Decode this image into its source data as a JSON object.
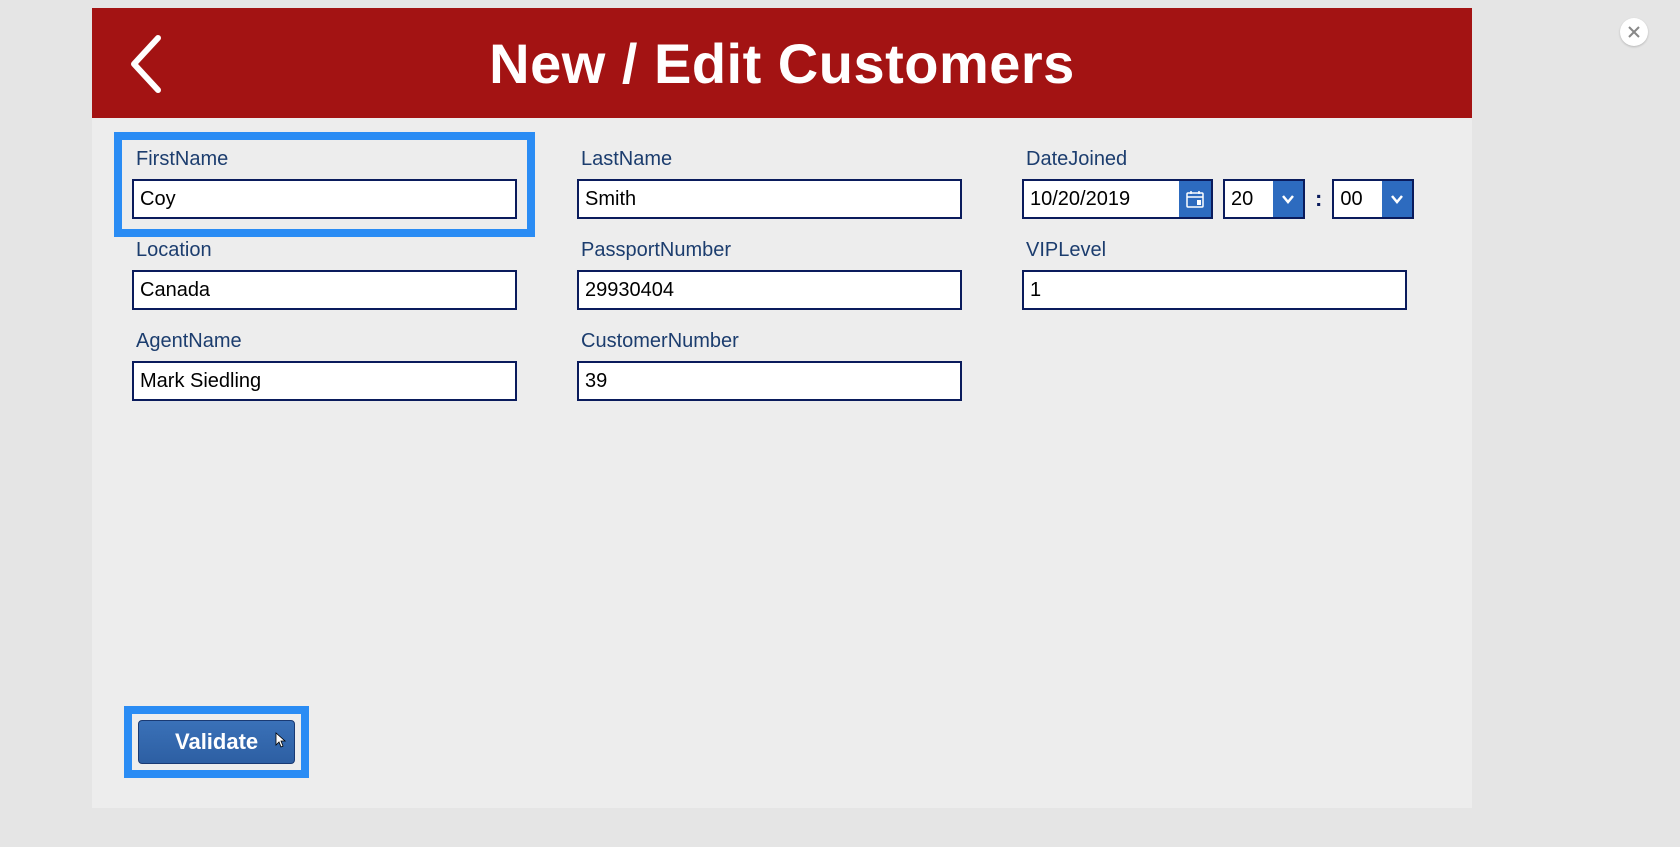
{
  "header": {
    "title": "New / Edit Customers"
  },
  "form": {
    "first_name_label": "FirstName",
    "first_name_value": "Coy",
    "last_name_label": "LastName",
    "last_name_value": "Smith",
    "date_joined_label": "DateJoined",
    "date_value": "10/20/2019",
    "hour_value": "20",
    "minute_value": "00",
    "time_separator": ":",
    "location_label": "Location",
    "location_value": "Canada",
    "passport_label": "PassportNumber",
    "passport_value": "29930404",
    "vip_label": "VIPLevel",
    "vip_value": "1",
    "agent_label": "AgentName",
    "agent_value": "Mark Siedling",
    "customer_number_label": "CustomerNumber",
    "customer_number_value": "39"
  },
  "actions": {
    "validate_label": "Validate"
  }
}
